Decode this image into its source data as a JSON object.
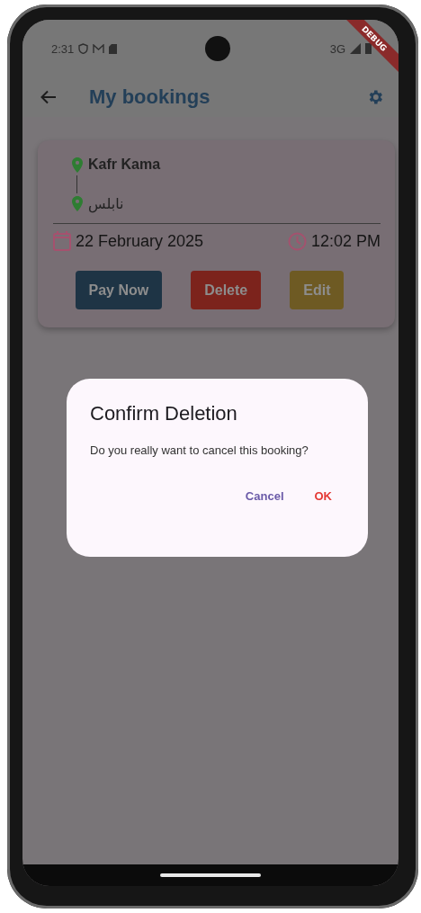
{
  "status_bar": {
    "time": "2:31",
    "network": "3G"
  },
  "debug_banner": "DEBUG",
  "app_bar": {
    "title": "My bookings"
  },
  "bookings": [
    {
      "from": "Kafr Kama",
      "to": "نابلس",
      "date": "22 February 2025",
      "time": "12:02 PM",
      "actions": [
        {
          "label": "Pay Now",
          "color": "#1e3445"
        },
        {
          "label": "Delete",
          "color": "#7c231c"
        },
        {
          "label": "Edit",
          "color": "#6e5a23"
        }
      ]
    }
  ],
  "dialog": {
    "title": "Confirm Deletion",
    "message": "Do you really want to cancel this booking?",
    "actions": [
      {
        "label": "Cancel",
        "color": "#6a5aa8"
      },
      {
        "label": "OK",
        "color": "#e53935"
      }
    ]
  }
}
